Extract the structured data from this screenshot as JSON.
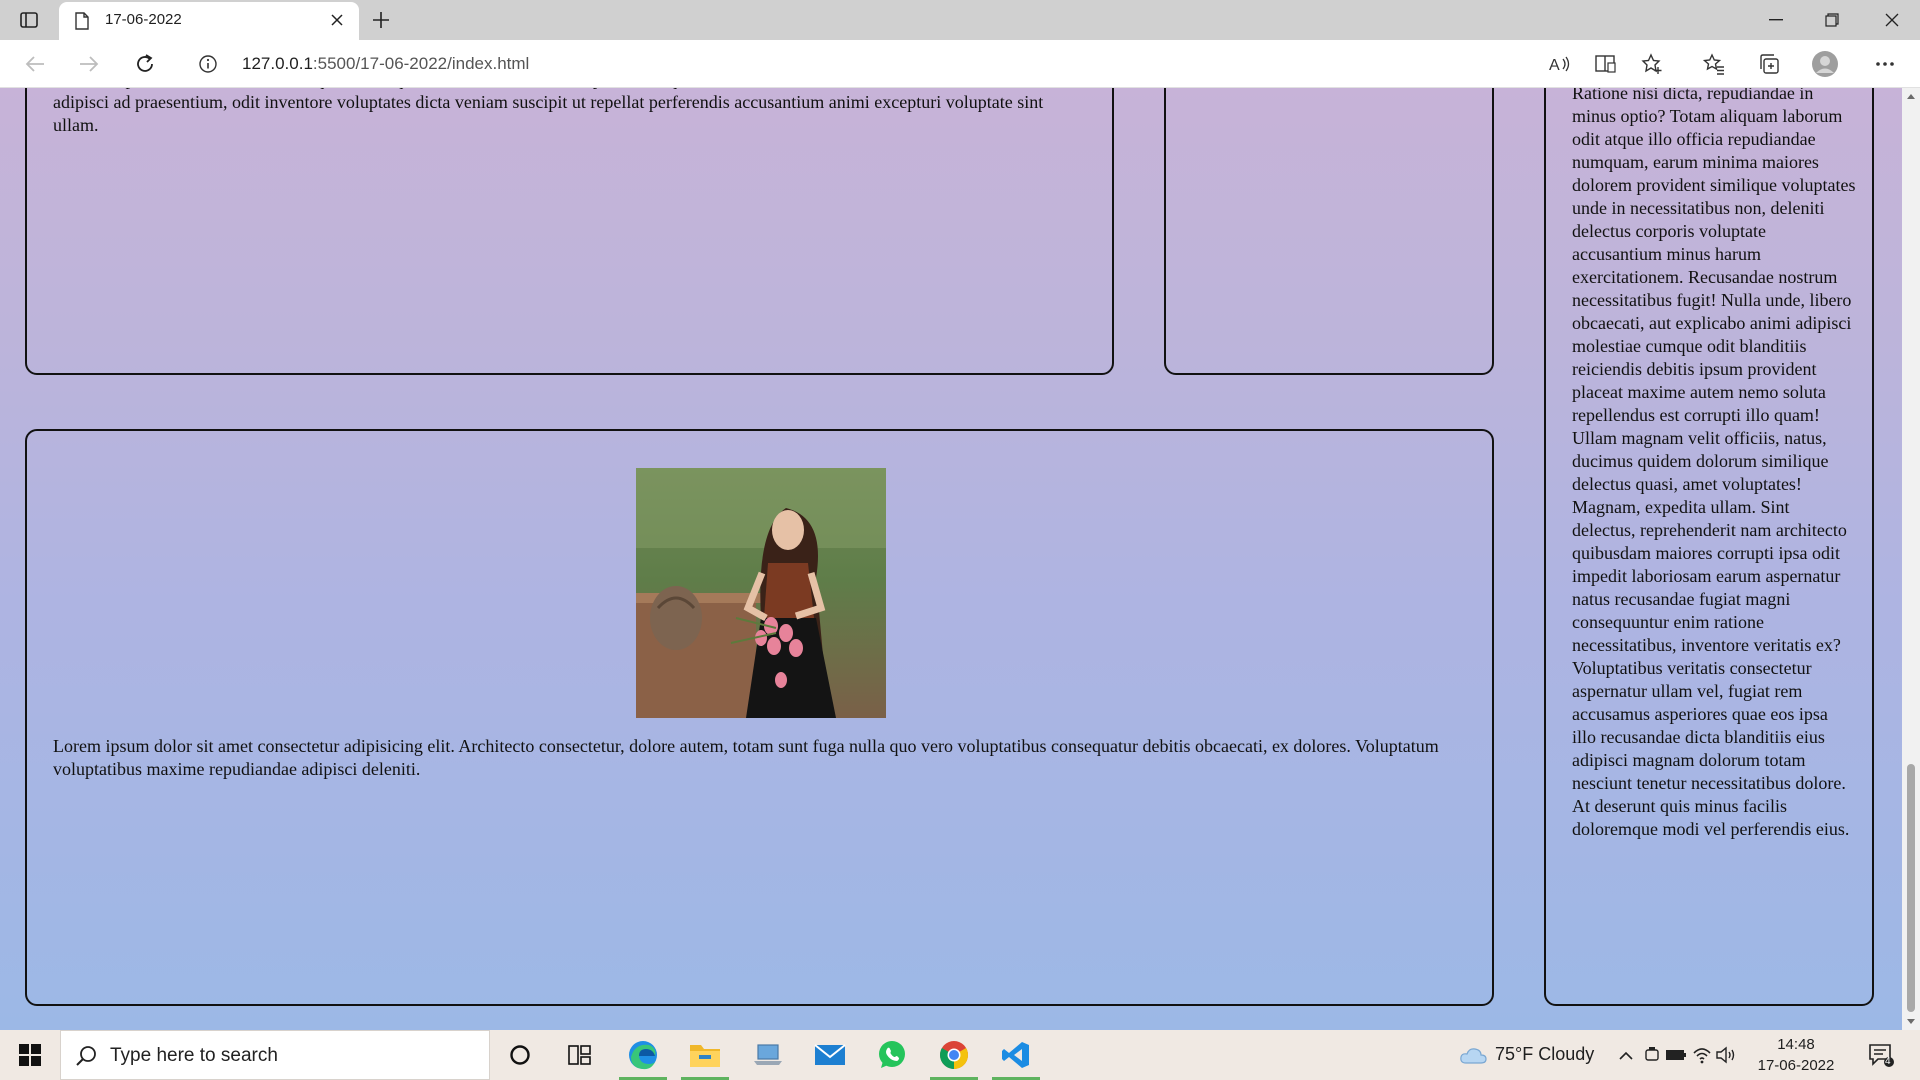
{
  "browser": {
    "tab_title": "17-06-2022",
    "url_host": "127.0.0.1",
    "url_path": ":5500/17-06-2022/index.html"
  },
  "page": {
    "top_left_text": "obcaecati praesentium, at sunt similique omnis quidem non commodi. Temporibus neque consectetur accusamus distinctio harum est rem. Eos adipisci ad praesentium, odit inventore voluptates dicta veniam suscipit ut repellat perferendis accusantium animi excepturi voluptate sint ullam.",
    "main_text": "Lorem ipsum dolor sit amet consectetur adipisicing elit. Architecto consectetur, dolore autem, totam sunt fuga nulla quo vero voluptatibus consequatur debitis obcaecati, ex dolores. Voluptatum voluptatibus maxime repudiandae adipisci deleniti.",
    "side_text": "Ratione nisi dicta, repudiandae in minus optio? Totam aliquam laborum odit atque illo officia repudiandae numquam, earum minima maiores dolorem provident similique voluptates unde in necessitatibus non, deleniti delectus corporis voluptate accusantium minus harum exercitationem. Recusandae nostrum necessitatibus fugit! Nulla unde, libero obcaecati, aut explicabo animi adipisci molestiae cumque odit blanditiis reiciendis debitis ipsum provident placeat maxime autem nemo soluta repellendus est corrupti illo quam! Ullam magnam velit officiis, natus, ducimus quidem dolorum similique delectus quasi, amet voluptates! Magnam, expedita ullam. Sint delectus, reprehenderit nam architecto quibusdam maiores corrupti ipsa odit impedit laboriosam earum aspernatur natus recusandae fugiat magni consequuntur enim ratione necessitatibus, inventore veritatis ex? Voluptatibus veritatis consectetur aspernatur ullam vel, fugiat rem accusamus asperiores quae eos ipsa illo recusandae dicta blanditiis eius adipisci magnam dolorum totam nesciunt tenetur necessitatibus dolore. At deserunt quis minus facilis doloremque modi vel perferendis eius."
  },
  "taskbar": {
    "search_placeholder": "Type here to search",
    "apps": [
      "cortana-icon",
      "task-view-icon",
      "edge-icon",
      "file-explorer-icon",
      "laptop-icon",
      "mail-icon",
      "whatsapp-icon",
      "chrome-icon",
      "vscode-icon"
    ],
    "weather": "75°F  Cloudy",
    "time": "14:48",
    "date": "17-06-2022",
    "notification_count": "4"
  },
  "colors": {
    "page_gradient_top": "#c7b3d8",
    "page_gradient_bottom": "#9cb8e6",
    "active_app_indicator": "#5fb35f"
  }
}
